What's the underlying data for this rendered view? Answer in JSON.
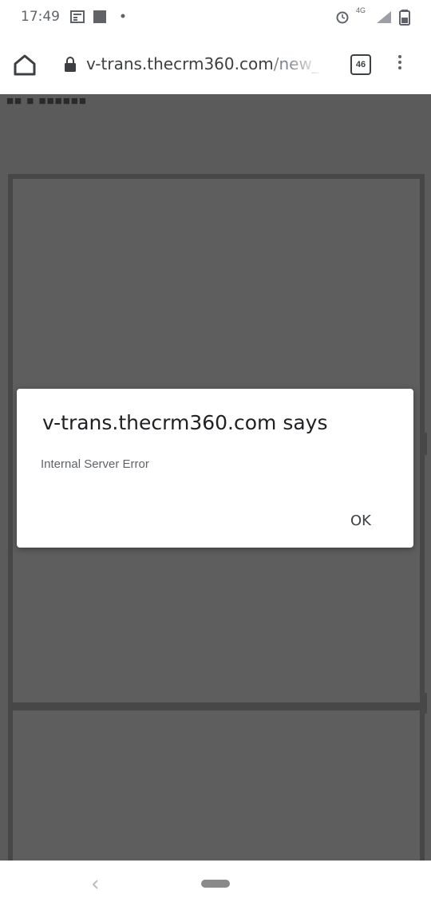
{
  "status_bar": {
    "time": "17:49",
    "network_label": "4G",
    "icons": [
      "news-icon",
      "gallery-icon",
      "notification-dot-icon",
      "alarm-icon",
      "signal-icon",
      "battery-icon"
    ]
  },
  "browser": {
    "url_host": "v-trans.thecrm360.com",
    "url_path": "/new_cr",
    "tab_count": "46"
  },
  "page": {
    "header_text": "■■ ■ ■■■■■■"
  },
  "dialog": {
    "title": "v-trans.thecrm360.com says",
    "message": "Internal Server Error",
    "ok_label": "OK"
  },
  "colors": {
    "overlay": "#5b5b5b",
    "dialog_bg": "#ffffff",
    "panel_border": "#474747"
  }
}
